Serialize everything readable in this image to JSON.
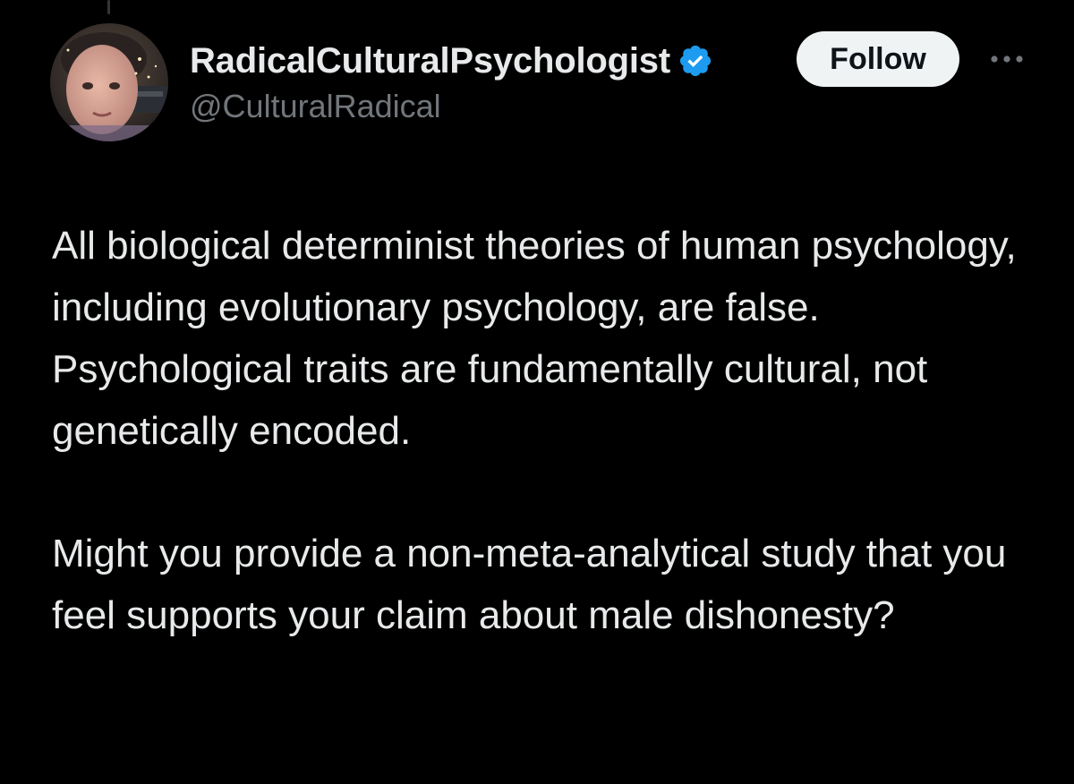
{
  "author": {
    "display_name": "RadicalCulturalPsychologist",
    "handle": "@CulturalRadical",
    "verified_icon": "verified-badge-icon",
    "avatar_icon": "profile-photo"
  },
  "actions": {
    "follow_label": "Follow",
    "more_icon": "more-horizontal-icon"
  },
  "tweet": {
    "paragraphs": [
      "All biological determinist theories of human psychology, including evolutionary psychology, are false. Psychological traits are fundamentally cultural, not genetically encoded.",
      "Might you provide a non-meta-analytical study that you feel supports your claim about male dishonesty?"
    ]
  },
  "colors": {
    "background": "#000000",
    "text": "#e7e9ea",
    "secondary_text": "#71767b",
    "verified": "#1d9bf0",
    "follow_bg": "#eff3f4"
  }
}
